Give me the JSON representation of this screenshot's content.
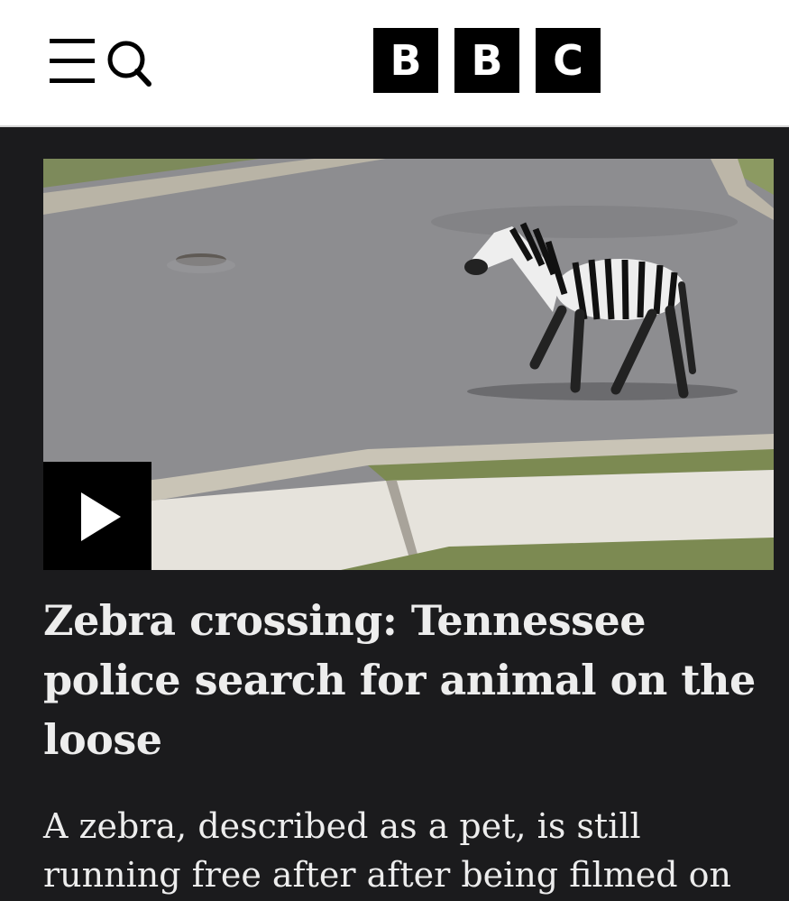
{
  "header": {
    "menu_icon": "menu-icon",
    "search_icon": "search-icon",
    "logo_letters": [
      "B",
      "B",
      "C"
    ],
    "background": "#ffffff"
  },
  "article": {
    "media": {
      "type": "video",
      "thumbnail_subject": "zebra-walking-on-road",
      "play_icon": "play-icon"
    },
    "headline": "Zebra crossing: Tennessee police search for animal on the loose",
    "summary": "A zebra, described as a pet, is still running free after after being filmed on"
  },
  "colors": {
    "page_background": "#1b1b1d",
    "text": "#ededed",
    "logo_block": "#000000"
  }
}
